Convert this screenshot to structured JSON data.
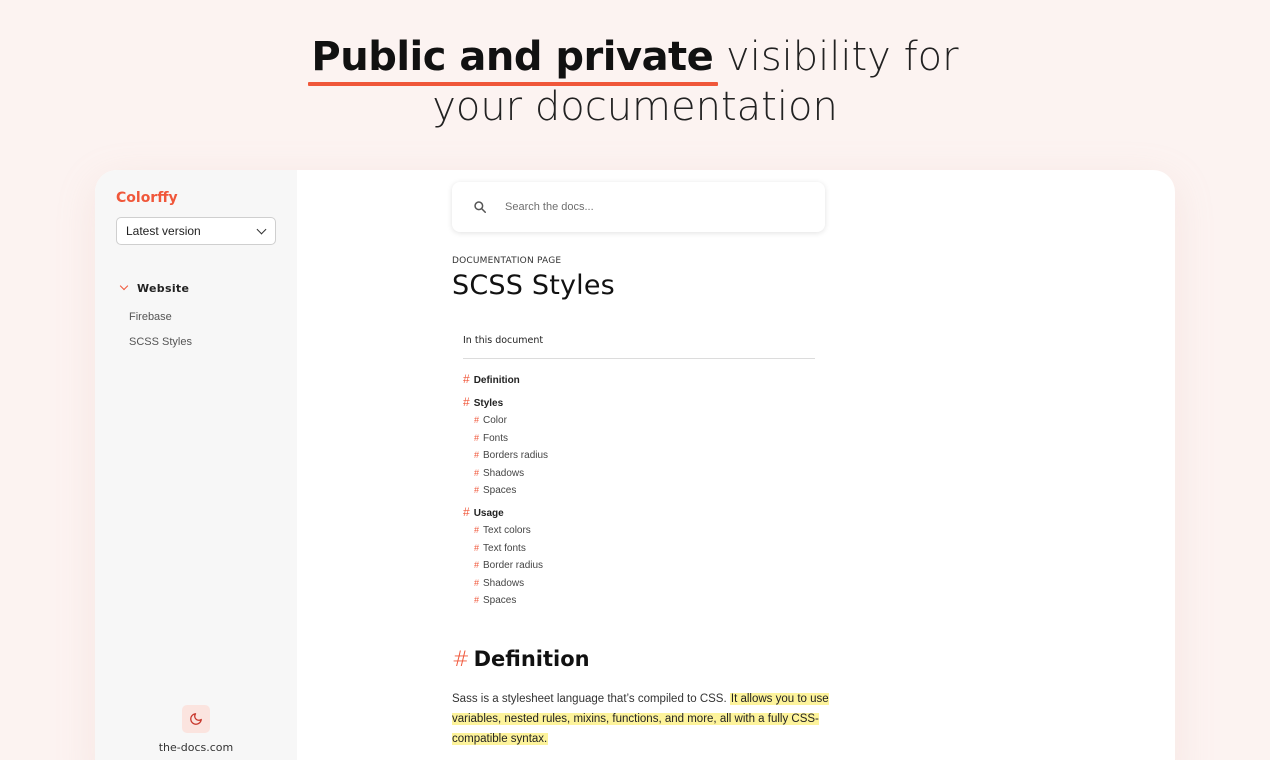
{
  "headline": {
    "bold": "Public and private",
    "rest": "visibility for",
    "line2": "your documentation"
  },
  "sidebar": {
    "brand": "Colorffy",
    "version_select": "Latest version",
    "group_label": "Website",
    "items": [
      {
        "label": "Firebase"
      },
      {
        "label": "SCSS Styles"
      }
    ],
    "theme_toggle_icon": "moon-icon",
    "site_url": "the-docs.com"
  },
  "search": {
    "placeholder": "Search the docs...",
    "icon": "search-icon"
  },
  "doc": {
    "kicker": "DOCUMENTATION PAGE",
    "title": "SCSS Styles"
  },
  "toc": {
    "heading": "In this document",
    "items": [
      {
        "label": "Definition",
        "level": 1
      },
      {
        "label": "Styles",
        "level": 1
      },
      {
        "label": "Color",
        "level": 2
      },
      {
        "label": "Fonts",
        "level": 2
      },
      {
        "label": "Borders radius",
        "level": 2
      },
      {
        "label": "Shadows",
        "level": 2
      },
      {
        "label": "Spaces",
        "level": 2
      },
      {
        "label": "Usage",
        "level": 1
      },
      {
        "label": "Text colors",
        "level": 2
      },
      {
        "label": "Text fonts",
        "level": 2
      },
      {
        "label": "Border radius",
        "level": 2
      },
      {
        "label": "Shadows",
        "level": 2
      },
      {
        "label": "Spaces",
        "level": 2
      }
    ]
  },
  "section": {
    "hash": "#",
    "title": "Definition",
    "text_plain": "Sass is a stylesheet language that’s compiled to CSS.",
    "text_highlight": "It allows you to use variables, nested rules, mixins, functions, and more, all with a fully CSS-compatible syntax."
  },
  "colors": {
    "accent": "#f0573a",
    "page_bg": "#fcf3f1",
    "sidebar_bg": "#f7f7f7",
    "highlight": "#fdf39b"
  }
}
